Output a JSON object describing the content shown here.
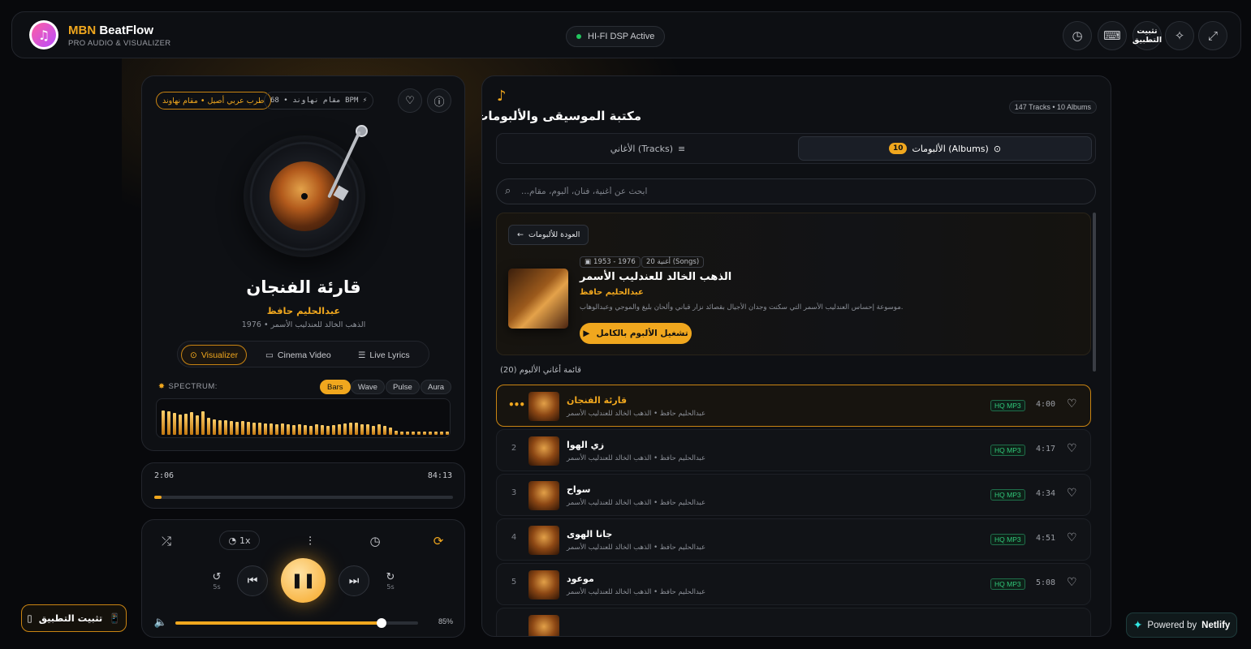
{
  "header": {
    "brand_main": "MBN",
    "brand_accent": "BeatFlow",
    "brand_sub": "PRO AUDIO & VISUALIZER",
    "dsp_status": "HI-FI DSP Active",
    "install_label": "تثبيت التطبيق",
    "icons": [
      "clock-icon",
      "keyboard-icon",
      "sparkle-icon",
      "expand-icon"
    ]
  },
  "player": {
    "tag": "طرب عربي أصيل • مقام نهاوند",
    "bpm": "مقام نهاوند • 68 BPM ⚡",
    "title": "قارئة الفنجان",
    "artist": "عبدالحليم حافظ",
    "album_year": "الذهب الخالد للعندليب الأسمر • 1976",
    "modes": [
      "Visualizer",
      "Cinema Video",
      "Live Lyrics"
    ],
    "active_mode": "Visualizer",
    "spectrum_label": "SPECTRUM:",
    "spectrum_styles": [
      "Bars",
      "Wave",
      "Pulse",
      "Aura"
    ],
    "active_spectrum": "Bars",
    "spectrum_levels": [
      0.72,
      0.68,
      0.64,
      0.6,
      0.62,
      0.66,
      0.58,
      0.7,
      0.5,
      0.46,
      0.44,
      0.42,
      0.4,
      0.38,
      0.4,
      0.37,
      0.36,
      0.35,
      0.34,
      0.33,
      0.32,
      0.34,
      0.3,
      0.29,
      0.3,
      0.28,
      0.27,
      0.3,
      0.29,
      0.26,
      0.28,
      0.3,
      0.33,
      0.36,
      0.35,
      0.32,
      0.3,
      0.27,
      0.3,
      0.25,
      0.22,
      0.12,
      0.1,
      0.1,
      0.1,
      0.1,
      0.1,
      0.1,
      0.1,
      0.1,
      0.1
    ],
    "time_current": "2:06",
    "time_total": "84:13",
    "progress": 0.025,
    "speed": "1x",
    "rewind_label": "5s",
    "forward_label": "5s",
    "volume_label": "85%",
    "volume": 0.85
  },
  "library": {
    "title": "مكتبة الموسيقى والألبومات",
    "count": "147 Tracks • 10 Albums",
    "tab_tracks": "الأغاني (Tracks)",
    "tab_albums": "الألبومات (Albums)",
    "albums_badge": "10",
    "search_placeholder": "ابحث عن أغنية، فنان، ألبوم، مقام...",
    "back_label": "العودة للألبومات",
    "album": {
      "songs_chip": "20 أغنية (Songs)",
      "years_chip": "1953 - 1976",
      "name": "الذهب الخالد للعندليب الأسمر",
      "artist": "عبدالحليم حافظ",
      "description": "موسوعة إحساس العندليب الأسمر التي سكنت وجدان الأجيال بقصائد نزار قباني وألحان بليغ والموجي وعبدالوهاب.",
      "play_label": "تشغيل الألبوم بالكامل"
    },
    "tracklist_title": "قائمة أغاني الألبوم (20)",
    "tracks": [
      {
        "num": "",
        "title": "قارئة الفنجان",
        "sub": "عبدالحليم حافظ • الذهب الخالد للعندليب الأسمر",
        "badge": "HQ MP3",
        "duration": "4:00"
      },
      {
        "num": "2",
        "title": "زي الهوا",
        "sub": "عبدالحليم حافظ • الذهب الخالد للعندليب الأسمر",
        "badge": "HQ MP3",
        "duration": "4:17"
      },
      {
        "num": "3",
        "title": "سواح",
        "sub": "عبدالحليم حافظ • الذهب الخالد للعندليب الأسمر",
        "badge": "HQ MP3",
        "duration": "4:34"
      },
      {
        "num": "4",
        "title": "جانا الهوى",
        "sub": "عبدالحليم حافظ • الذهب الخالد للعندليب الأسمر",
        "badge": "HQ MP3",
        "duration": "4:51"
      },
      {
        "num": "5",
        "title": "موعود",
        "sub": "عبدالحليم حافظ • الذهب الخالد للعندليب الأسمر",
        "badge": "HQ MP3",
        "duration": "5:08"
      }
    ]
  },
  "footer": {
    "install_fab": "تثبيت التطبيق",
    "netlify_prefix": "Powered by",
    "netlify_brand": "Netlify"
  },
  "colors": {
    "accent": "#f0a71e",
    "background": "#08090c",
    "success": "#22c55e"
  }
}
